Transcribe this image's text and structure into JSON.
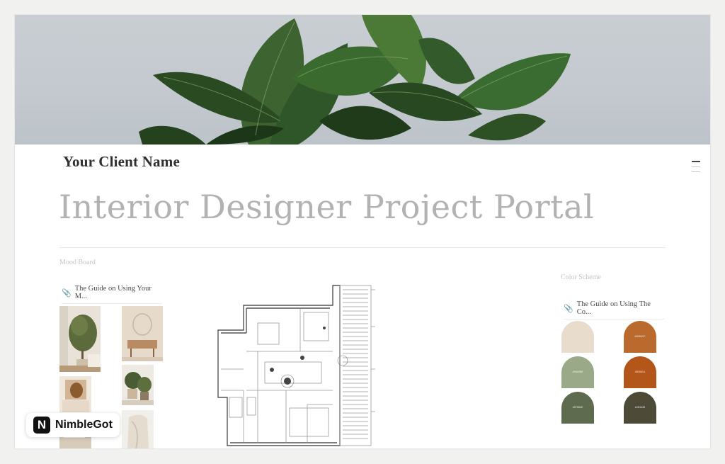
{
  "page": {
    "client_name": "Your Client Name",
    "title": "Interior Designer Project Portal"
  },
  "mood_board": {
    "label": "Mood Board",
    "guide_link": "The Guide on Using Your M..."
  },
  "color_scheme": {
    "label": "Color Scheme",
    "guide_link": "The Guide on Using The Co...",
    "swatches": [
      {
        "color": "#e8dccd",
        "code": ""
      },
      {
        "color": "#b96a2c",
        "code": "#B96A2C"
      },
      {
        "color": "#9aa988",
        "code": "#9AA988"
      },
      {
        "color": "#b3561a",
        "code": "#B3561A"
      },
      {
        "color": "#5f6b4e",
        "code": "#5F6B4E"
      },
      {
        "color": "#4e4a38",
        "code": "#4E4A38"
      }
    ]
  },
  "badge": {
    "logo_letter": "N",
    "text": "NimbleGot"
  }
}
